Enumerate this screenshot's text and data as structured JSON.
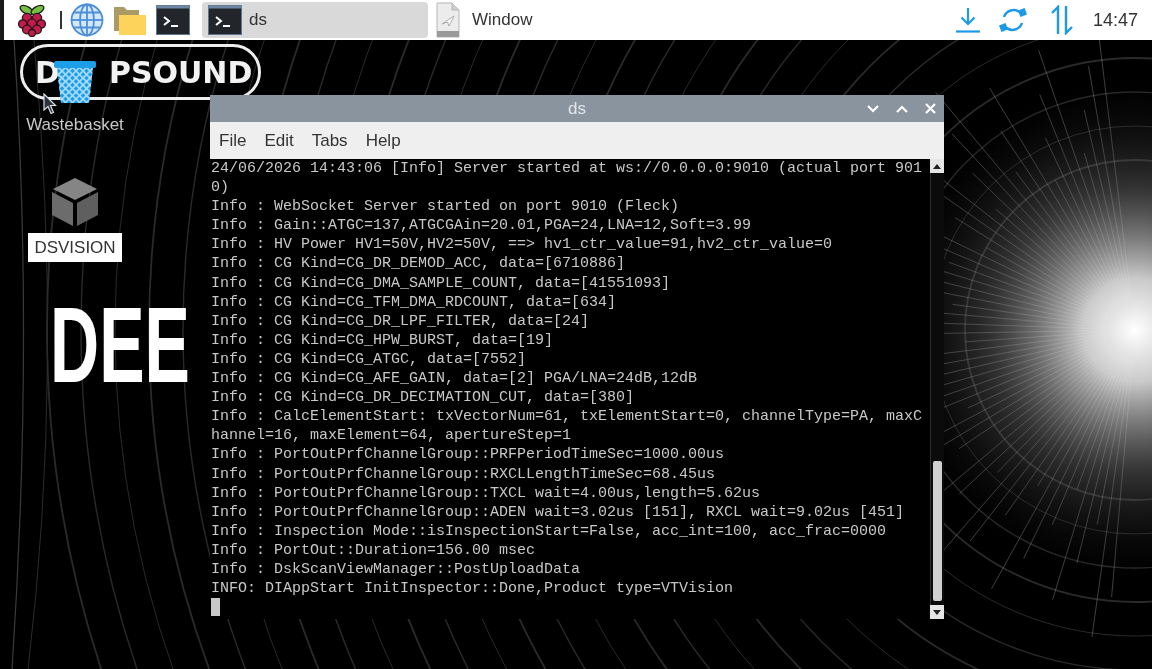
{
  "taskbar": {
    "tasks": [
      {
        "kind": "terminal",
        "label": "ds",
        "selected": true
      },
      {
        "kind": "document",
        "label": "Window",
        "selected": false
      }
    ],
    "clock": "14:47"
  },
  "wallpaper": {
    "logo": [
      "D",
      "PSOUND"
    ],
    "headline": "DEE"
  },
  "desktop_icons": [
    {
      "kind": "trash",
      "label": "Wastebasket",
      "selected": false
    },
    {
      "kind": "cube",
      "label": "DSVISION",
      "selected": true
    }
  ],
  "terminal": {
    "title": "ds",
    "menu": [
      "File",
      "Edit",
      "Tabs",
      "Help"
    ],
    "lines": [
      "24/06/2026 14:43:06 [Info] Server started at ws://0.0.0.0:9010 (actual port 9010)",
      "Info : WebSocket Server started on port 9010 (Fleck)",
      "Info : Gain::ATGC=137,ATGCGAin=20.01,PGA=24,LNA=12,Soft=3.99",
      "Info : HV Power HV1=50V,HV2=50V, ==> hv1_ctr_value=91,hv2_ctr_value=0",
      "Info : CG Kind=CG_DR_DEMOD_ACC, data=[6710886]",
      "Info : CG Kind=CG_DMA_SAMPLE_COUNT, data=[41551093]",
      "Info : CG Kind=CG_TFM_DMA_RDCOUNT, data=[634]",
      "Info : CG Kind=CG_DR_LPF_FILTER, data=[24]",
      "Info : CG Kind=CG_HPW_BURST, data=[19]",
      "Info : CG Kind=CG_ATGC, data=[7552]",
      "Info : CG Kind=CG_AFE_GAIN, data=[2] PGA/LNA=24dB,12dB",
      "Info : CG Kind=CG_DR_DECIMATION_CUT, data=[380]",
      "Info : CalcElementStart: txVectorNum=61, txElementStart=0, channelType=PA, maxChannel=16, maxElement=64, apertureStep=1",
      "Info : PortOutPrfChannelGroup::PRFPeriodTimeSec=1000.00us",
      "Info : PortOutPrfChannelGroup::RXCLLengthTimeSec=68.45us",
      "Info : PortOutPrfChannelGroup::TXCL wait=4.00us,length=5.62us",
      "Info : PortOutPrfChannelGroup::ADEN wait=3.02us [151], RXCL wait=9.02us [451]",
      "Info : Inspection Mode::isInspectionStart=False, acc_int=100, acc_frac=0000",
      "Info : PortOut::Duration=156.00 msec",
      "Info : DskScanViewManager::PostUploadData",
      "INFO: DIAppStart InitInspector::Done,Product type=VTVision"
    ]
  }
}
